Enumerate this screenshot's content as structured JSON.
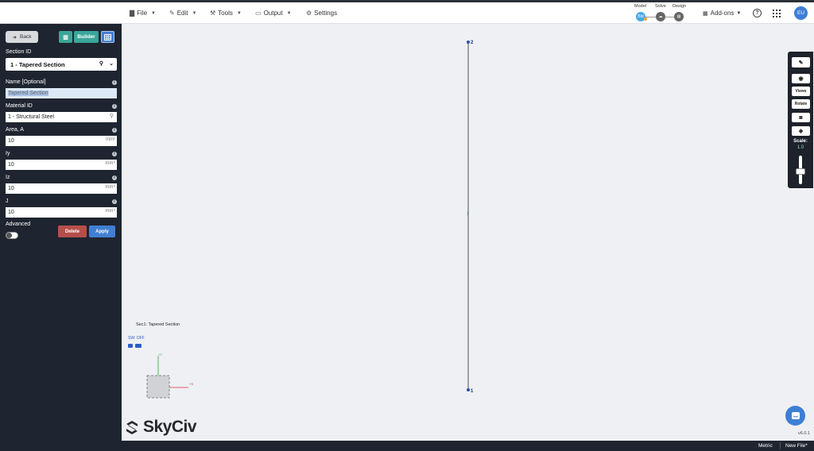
{
  "menu": {
    "file": "File",
    "edit": "Edit",
    "tools": "Tools",
    "output": "Output",
    "settings": "Settings"
  },
  "stepper": {
    "model": "Model",
    "solve": "Solve",
    "design": "Design",
    "model_badge": "Bld"
  },
  "addons": "Add-ons",
  "help": "?",
  "avatar": "EU",
  "sidebar": {
    "back": "Back",
    "builder": "Builder",
    "section_id_label": "Section ID",
    "section_id_value": "1 - Tapered Section",
    "name_label": "Name [Optional]",
    "name_value": "Tapered Section",
    "material_label": "Material ID",
    "material_value": "1 - Structural Steel",
    "area_label": "Area, A",
    "area_value": "10",
    "area_unit": "mm²",
    "iy_label": "Iy",
    "iy_value": "10",
    "iy_unit": "mm⁴",
    "iz_label": "Iz",
    "iz_value": "10",
    "iz_unit": "mm⁴",
    "j_label": "J",
    "j_value": "10",
    "j_unit": "mm⁴",
    "advanced_label": "Advanced",
    "advanced_on": false,
    "delete": "Delete",
    "apply": "Apply"
  },
  "viewport": {
    "node_top": "2",
    "node_bottom": "1",
    "member_label": "1",
    "section_label": "Sec1: Tapered Section",
    "sw_label": "SW: OFF",
    "axis_y": "+Y",
    "axis_x": "+X"
  },
  "logo": "SkyCiv",
  "right_toolbar": {
    "views": "Views",
    "rotate": "Rotate",
    "scale_label": "Scale:",
    "scale_value": "1.0"
  },
  "version": "v6.0.1",
  "bottombar": {
    "metric": "Metric",
    "new_file": "New File*"
  },
  "colors": {
    "sidebar_bg": "#1f2530",
    "accent_blue": "#3f7fd4",
    "teal": "#3aa69a",
    "delete_red": "#b74e4a",
    "member": "#4a5060"
  }
}
